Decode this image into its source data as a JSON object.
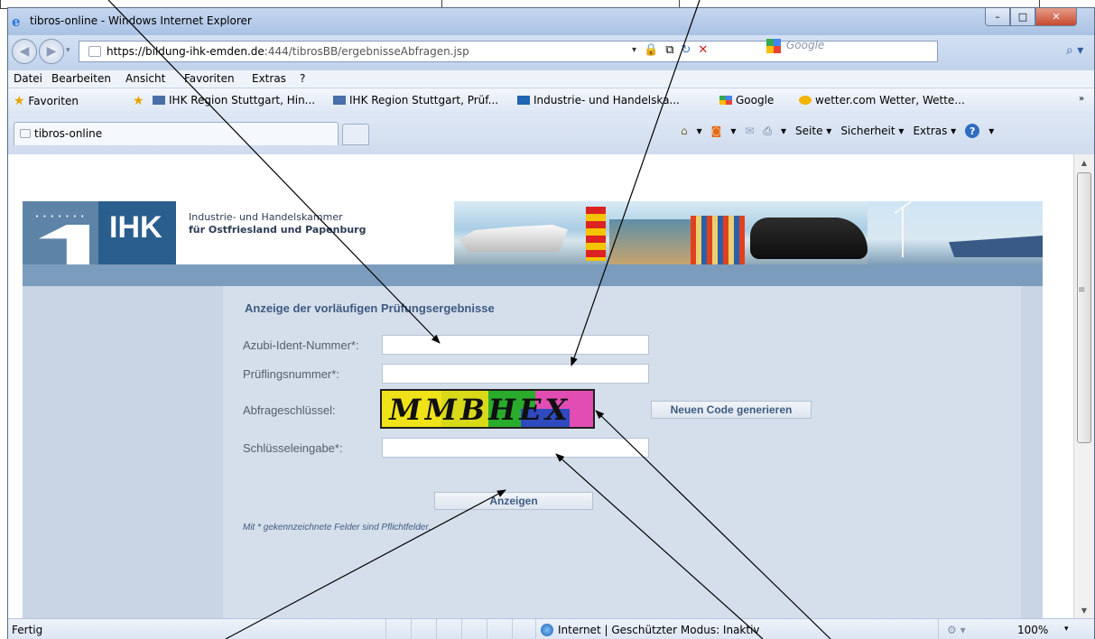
{
  "window": {
    "title": "tibros-online - Windows Internet Explorer",
    "min_glyph": "–",
    "max_glyph": "□",
    "close_glyph": "✕"
  },
  "nav": {
    "back_glyph": "◀",
    "forward_glyph": "▶",
    "history_glyph": "▾"
  },
  "address": {
    "url_domain": "https://bildung-ihk-emden.de",
    "url_rest": ":444/tibrosBB/ergebnisseAbfragen.jsp",
    "dropdown_glyph": "▾",
    "lock_glyph": "🔒",
    "compat_glyph": "⧉",
    "refresh_glyph": "↻",
    "stop_glyph": "✕"
  },
  "search": {
    "placeholder": "Google",
    "icon_glyph": "⌕",
    "drop_glyph": "▾"
  },
  "menu": [
    "Datei",
    "Bearbeiten",
    "Ansicht",
    "Favoriten",
    "Extras",
    "?"
  ],
  "favorites": {
    "label": "Favoriten",
    "items": [
      "IHK Region Stuttgart, Hin...",
      "IHK Region Stuttgart, Prüf...",
      "Industrie- und Handelska...",
      "Google",
      "wetter.com Wetter, Wette..."
    ],
    "overflow": "»"
  },
  "tabs": {
    "active_label": "tibros-online"
  },
  "commandbar": {
    "home_glyph": "⌂",
    "rss_glyph": "◙",
    "mail_glyph": "✉",
    "print_glyph": "⎙",
    "drop_glyph": "▾",
    "page_label": "Seite ▾",
    "safety_label": "Sicherheit ▾",
    "tools_label": "Extras ▾",
    "help_glyph": "?"
  },
  "header": {
    "logo_text": "IHK",
    "org_line1": "Industrie- und Handelskammer",
    "org_line2": "für Ostfriesland und Papenburg"
  },
  "form": {
    "title": "Anzeige der vorläufigen Prüfungsergebnisse",
    "azubi_label": "Azubi-Ident-Nummer*:",
    "azubi_value": "",
    "pruef_label": "Prüflingsnummer*:",
    "pruef_value": "",
    "key_label": "Abfrageschlüssel:",
    "captcha_text": "MMBHEX",
    "new_code_button": "Neuen Code generieren",
    "key_input_label": "Schlüsseleingabe*:",
    "key_input_value": "",
    "submit_button": "Anzeigen",
    "note": "Mit * gekennzeichnete Felder sind Pflichtfelder."
  },
  "statusbar": {
    "status": "Fertig",
    "zone": "Internet | Geschützter Modus: Inaktiv",
    "protect_glyph": "⚙ ▾",
    "zoom": "100%",
    "zoom_drop": "▾"
  },
  "annotation": {
    "arrow_color": "#000000"
  }
}
